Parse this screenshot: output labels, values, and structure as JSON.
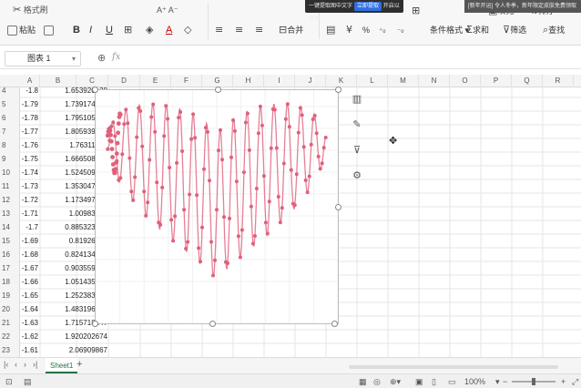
{
  "toast": {
    "text": "一键提取图中文字",
    "button": "立即提取",
    "extra": "开启以截图"
  },
  "ad": {
    "text": "[新年开运] 令人冬季，新年限定皮肤免费领取"
  },
  "ribbon": {
    "top": {
      "format_painter": "格式刷",
      "font_size_hint": "A⁺ A⁻"
    },
    "paste_label": "粘贴",
    "bold": "B",
    "italic": "I",
    "underline": "U",
    "font_color": "A",
    "merge_label": "合并",
    "number_format": "%",
    "cond_format_label": "条件格式",
    "fill_label": "填充",
    "sort_label": "排序",
    "filter_label": "筛选",
    "sum_label": "求和",
    "find_label": "查找"
  },
  "formula_bar": {
    "name_box": "图表 1",
    "fx": "fx"
  },
  "columns": [
    "A",
    "B",
    "C",
    "D",
    "E",
    "F",
    "G",
    "H",
    "I",
    "J",
    "K",
    "L",
    "M",
    "N",
    "O",
    "P",
    "Q",
    "R"
  ],
  "rows": [
    {
      "n": "4",
      "a": "-1.8",
      "b": "1.653920138"
    },
    {
      "n": "5",
      "a": "-1.79",
      "b": "1.739174584"
    },
    {
      "n": "6",
      "a": "-1.78",
      "b": "1.795105836"
    },
    {
      "n": "7",
      "a": "-1.77",
      "b": "1.805939747"
    },
    {
      "n": "8",
      "a": "-1.76",
      "b": "1.76311973"
    },
    {
      "n": "9",
      "a": "-1.75",
      "b": "1.666508517"
    },
    {
      "n": "10",
      "a": "-1.74",
      "b": "1.524509802"
    },
    {
      "n": "11",
      "a": "-1.73",
      "b": "1.353047012"
    },
    {
      "n": "12",
      "a": "-1.72",
      "b": "1.173497283"
    },
    {
      "n": "13",
      "a": "-1.71",
      "b": "1.00983107"
    },
    {
      "n": "14",
      "a": "-1.7",
      "b": "0.885323338"
    },
    {
      "n": "15",
      "a": "-1.69",
      "b": "0.81926787"
    },
    {
      "n": "16",
      "a": "-1.68",
      "b": "0.824134499"
    },
    {
      "n": "17",
      "a": "-1.67",
      "b": "0.903559028"
    },
    {
      "n": "18",
      "a": "-1.66",
      "b": "1.051435569"
    },
    {
      "n": "19",
      "a": "-1.65",
      "b": "1.252383725"
    },
    {
      "n": "20",
      "a": "-1.64",
      "b": "1.483196339"
    },
    {
      "n": "21",
      "a": "-1.63",
      "b": "1.715718147"
    },
    {
      "n": "22",
      "a": "-1.62",
      "b": "1.920202674"
    },
    {
      "n": "23",
      "a": "-1.61",
      "b": "2.06909867"
    },
    {
      "n": "24",
      "a": "-1.6",
      "b": "2.140662306"
    },
    {
      "n": "25",
      "a": "-1.59",
      "b": "2.121944429"
    }
  ],
  "chart_tools": [
    "chart-elements-icon",
    "chart-style-icon",
    "chart-filter-icon",
    "chart-settings-icon"
  ],
  "chart_data": {
    "type": "scatter",
    "marker_color": "#e0607a",
    "x_source_column": "A",
    "y_source_column": "B",
    "title": "",
    "xlabel": "",
    "ylabel": "",
    "xlim": [
      -1.85,
      1.85
    ],
    "ylim": [
      -1.6,
      2.3
    ],
    "axes_visible": false,
    "gridlines": true,
    "series": [
      {
        "x": [
          -1.8,
          -1.79,
          -1.78,
          -1.77,
          -1.76,
          -1.75,
          -1.74,
          -1.73,
          -1.72,
          -1.71,
          -1.7,
          -1.69,
          -1.68,
          -1.67,
          -1.66,
          -1.65,
          -1.64,
          -1.63,
          -1.62,
          -1.61,
          -1.6,
          -1.59
        ],
        "y": [
          1.653920138,
          1.739174584,
          1.795105836,
          1.805939747,
          1.76311973,
          1.666508517,
          1.524509802,
          1.353047012,
          1.173497283,
          1.00983107,
          0.885323338,
          0.81926787,
          0.824134499,
          0.903559028,
          1.051435569,
          1.252383725,
          1.483196339,
          1.715718147,
          1.920202674,
          2.06909867,
          2.140662306,
          2.121944429
        ]
      }
    ]
  },
  "sheet_bar": {
    "tab": "Sheet1",
    "add": "+"
  },
  "status_bar": {
    "zoom": "100%"
  }
}
